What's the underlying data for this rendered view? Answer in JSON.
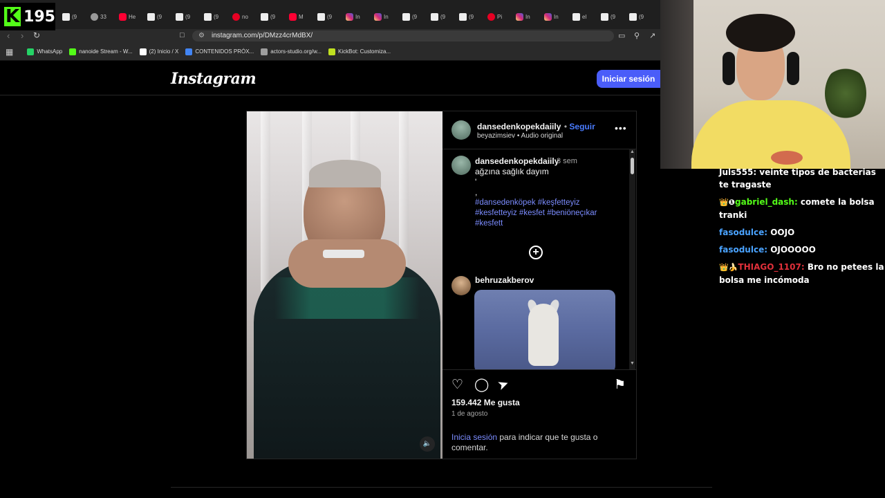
{
  "browser": {
    "kick_count": "195",
    "kick_logo": "K",
    "tabs": [
      {
        "icon": "tiktok-icon",
        "label": "(9"
      },
      {
        "icon": "github-icon",
        "label": "33"
      },
      {
        "icon": "youtube-icon",
        "label": "He"
      },
      {
        "icon": "tiktok-icon",
        "label": "(9"
      },
      {
        "icon": "tiktok-icon",
        "label": "(9"
      },
      {
        "icon": "tiktok-icon",
        "label": "(9"
      },
      {
        "icon": "pinterest-icon",
        "label": "no"
      },
      {
        "icon": "tiktok-icon",
        "label": "(9"
      },
      {
        "icon": "youtube-icon",
        "label": "M"
      },
      {
        "icon": "tiktok-icon",
        "label": "(9"
      },
      {
        "icon": "instagram-icon",
        "label": "In"
      },
      {
        "icon": "instagram-icon",
        "label": "In"
      },
      {
        "icon": "tiktok-icon",
        "label": "(9"
      },
      {
        "icon": "tiktok-icon",
        "label": "(9"
      },
      {
        "icon": "tiktok-icon",
        "label": "(9"
      },
      {
        "icon": "pinterest-icon",
        "label": "Pi"
      },
      {
        "icon": "instagram-icon",
        "label": "In"
      },
      {
        "icon": "instagram-icon",
        "label": "In"
      },
      {
        "icon": "tiktok-icon",
        "label": "el"
      },
      {
        "icon": "tiktok-icon",
        "label": "(9"
      },
      {
        "icon": "tiktok-icon",
        "label": "(9"
      }
    ],
    "url": "instagram.com/p/DMzz4crMdBX/",
    "bookmarks": [
      {
        "label": "WhatsApp",
        "color": "#25d366"
      },
      {
        "label": "nanoide Stream - W...",
        "color": "#53fc18"
      },
      {
        "label": "(2) Inicio / X",
        "color": "#ffffff"
      },
      {
        "label": "CONTENIDOS PRÓX...",
        "color": "#4285f4"
      },
      {
        "label": "actors-studio.org/w...",
        "color": "#9e9e9e"
      },
      {
        "label": "KickBot: Customiza...",
        "color": "#c0e020"
      }
    ]
  },
  "instagram": {
    "logo": "Instagram",
    "login_button": "Iniciar sesión",
    "post": {
      "author": "dansedenkopekdaiily",
      "follow": "Seguir",
      "audio_user": "beyazimsiev",
      "audio_label": "Audio original",
      "caption_user": "dansedenkopekdaiily",
      "caption_time": "3 sem",
      "caption_text": "ağzına sağlık dayım\n'\n,",
      "hashtags": "#dansedenköpek #keşfetteyiz #kesfetteyiz #kesfet #beniöneçıkar #kesfett",
      "comment_user": "behruzakberov",
      "likes": "159.442 Me gusta",
      "date": "1 de agosto",
      "login_link": "Inicia sesión",
      "login_rest": " para indicar que te gusta o comentar."
    }
  },
  "chat": [
    {
      "badges": "",
      "user": "Juls555:",
      "user_color": "#ffffff",
      "text": " veinte tipos de bacterias te tragaste"
    },
    {
      "badges": "👑❶",
      "user": "gabriel_dash:",
      "user_color": "#53fc18",
      "text": " comete la bolsa tranki"
    },
    {
      "badges": "",
      "user": "fasodulce:",
      "user_color": "#4aa3ff",
      "text": " OOJO"
    },
    {
      "badges": "",
      "user": "fasodulce:",
      "user_color": "#4aa3ff",
      "text": " OJOOOOO"
    },
    {
      "badges": "👑🍌",
      "user": "THIAGO_1107:",
      "user_color": "#e0303a",
      "text": " Bro no petees la bolsa me incómoda"
    }
  ]
}
